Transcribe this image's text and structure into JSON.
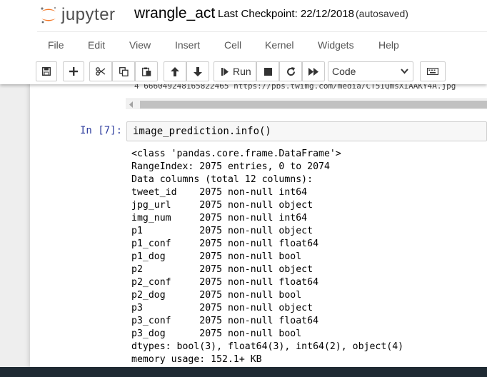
{
  "app": {
    "logo_text": "jupyter",
    "notebook_name": "wrangle_act",
    "checkpoint": "Last Checkpoint: 22/12/2018",
    "autosave": "(autosaved)"
  },
  "menubar": {
    "items": [
      "File",
      "Edit",
      "View",
      "Insert",
      "Cell",
      "Kernel",
      "Widgets",
      "Help"
    ]
  },
  "toolbar": {
    "run_label": "Run",
    "cell_type": "Code",
    "cell_type_options": [
      "Code"
    ]
  },
  "previous_output": {
    "row_text": "4   666049248165822465      https://pbs.twimg.com/media/CT5IQmsXIAAKY4A.jpg"
  },
  "cell": {
    "prompt": "In [7]:",
    "code": "image_prediction.info()",
    "output_lines": [
      "<class 'pandas.core.frame.DataFrame'>",
      "RangeIndex: 2075 entries, 0 to 2074",
      "Data columns (total 12 columns):",
      "tweet_id    2075 non-null int64",
      "jpg_url     2075 non-null object",
      "img_num     2075 non-null int64",
      "p1          2075 non-null object",
      "p1_conf     2075 non-null float64",
      "p1_dog      2075 non-null bool",
      "p2          2075 non-null object",
      "p2_conf     2075 non-null float64",
      "p2_dog      2075 non-null bool",
      "p3          2075 non-null object",
      "p3_conf     2075 non-null float64",
      "p3_dog      2075 non-null bool",
      "dtypes: bool(3), float64(3), int64(2), object(4)",
      "memory usage: 152.1+ KB"
    ]
  },
  "colors": {
    "prompt": "#303F9F",
    "logo_orange": "#F37726",
    "bottom_bar": "#1f2a33"
  }
}
